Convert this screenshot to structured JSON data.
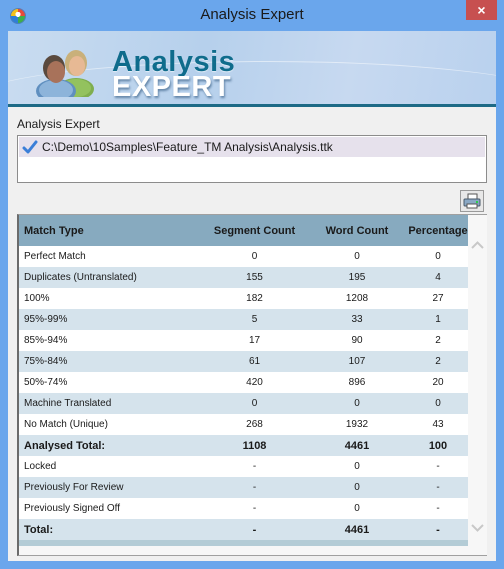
{
  "window": {
    "title": "Analysis Expert",
    "close_label": "×"
  },
  "banner": {
    "line1": "Analysis",
    "line2": "EXPERT"
  },
  "section": {
    "label": "Analysis Expert"
  },
  "file_list": {
    "items": [
      {
        "path": "C:\\Demo\\10Samples\\Feature_TM Analysis\\Analysis.ttk",
        "checked": true
      }
    ]
  },
  "toolbar": {
    "print_icon": "printer-icon"
  },
  "table": {
    "columns": [
      "Match Type",
      "Segment Count",
      "Word Count",
      "Percentage"
    ],
    "rows": [
      {
        "type": "Perfect Match",
        "segments": "0",
        "words": "0",
        "percent": "0",
        "bold": false
      },
      {
        "type": "Duplicates (Untranslated)",
        "segments": "155",
        "words": "195",
        "percent": "4",
        "bold": false
      },
      {
        "type": "100%",
        "segments": "182",
        "words": "1208",
        "percent": "27",
        "bold": false
      },
      {
        "type": "95%-99%",
        "segments": "5",
        "words": "33",
        "percent": "1",
        "bold": false
      },
      {
        "type": "85%-94%",
        "segments": "17",
        "words": "90",
        "percent": "2",
        "bold": false
      },
      {
        "type": "75%-84%",
        "segments": "61",
        "words": "107",
        "percent": "2",
        "bold": false
      },
      {
        "type": "50%-74%",
        "segments": "420",
        "words": "896",
        "percent": "20",
        "bold": false
      },
      {
        "type": "Machine Translated",
        "segments": "0",
        "words": "0",
        "percent": "0",
        "bold": false
      },
      {
        "type": "No Match (Unique)",
        "segments": "268",
        "words": "1932",
        "percent": "43",
        "bold": false
      },
      {
        "type": "Analysed Total:",
        "segments": "1108",
        "words": "4461",
        "percent": "100",
        "bold": true
      },
      {
        "type": "Locked",
        "segments": "-",
        "words": "0",
        "percent": "-",
        "bold": false
      },
      {
        "type": "Previously For Review",
        "segments": "-",
        "words": "0",
        "percent": "-",
        "bold": false
      },
      {
        "type": "Previously Signed Off",
        "segments": "-",
        "words": "0",
        "percent": "-",
        "bold": false
      },
      {
        "type": "Total:",
        "segments": "-",
        "words": "4461",
        "percent": "-",
        "bold": true
      }
    ]
  },
  "colors": {
    "titlebar": "#6aa6ec",
    "close": "#c75050",
    "header": "#87aabf",
    "row_alt": "#d5e3ec",
    "banner_accent": "#0f6c8c"
  }
}
